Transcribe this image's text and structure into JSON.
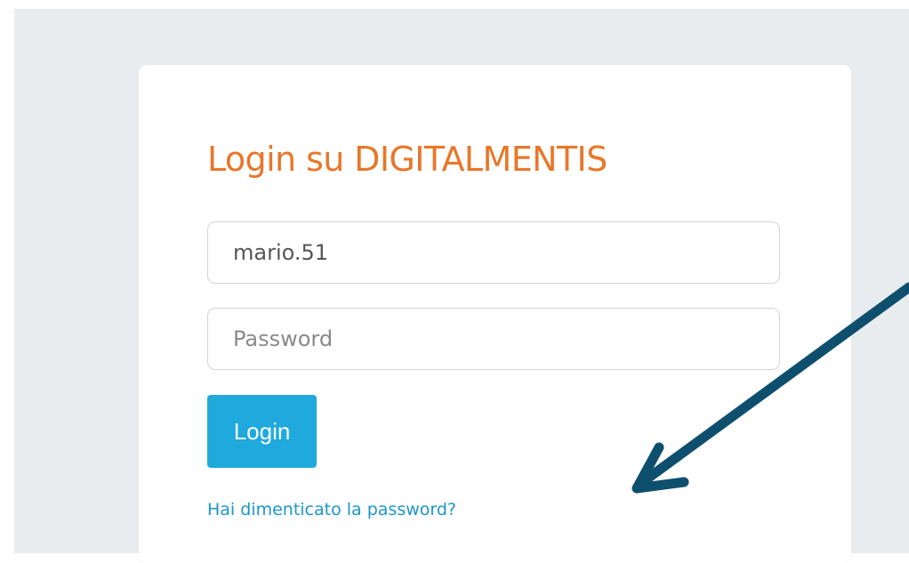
{
  "login": {
    "title": "Login su DIGITALMENTIS",
    "username_value": "mario.51",
    "password_placeholder": "Password",
    "login_button_label": "Login",
    "forgot_password_link": "Hai dimenticato la password?"
  },
  "colors": {
    "title": "#e8772a",
    "button": "#1fa9dd",
    "link": "#1b97c9",
    "annotation_arrow": "#0f4f6e",
    "page_background": "#e9ecef"
  },
  "annotation": {
    "icon": "arrow-pointing-to-forgot-password"
  }
}
